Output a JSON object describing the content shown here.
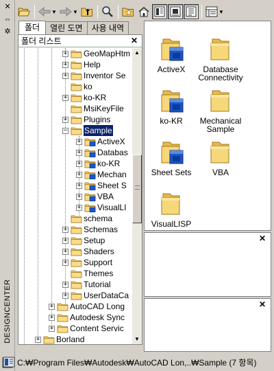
{
  "panel_title": "DESIGNCENTER",
  "tabs": [
    {
      "label": "폴더",
      "active": true
    },
    {
      "label": "열린 도면",
      "active": false
    },
    {
      "label": "사용 내역",
      "active": false
    }
  ],
  "tree_header": "폴더 리스트",
  "tree": [
    {
      "label": "GeoMapHtm"
    },
    {
      "label": "Help"
    },
    {
      "label": "Inventor Se"
    },
    {
      "label": "ko"
    },
    {
      "label": "ko-KR"
    },
    {
      "label": "MsiKeyFile"
    },
    {
      "label": "Plugins"
    },
    {
      "label": "Sample",
      "selected": true
    },
    {
      "label": "ActiveX"
    },
    {
      "label": "Databas"
    },
    {
      "label": "ko-KR"
    },
    {
      "label": "Mechan"
    },
    {
      "label": "Sheet S"
    },
    {
      "label": "VBA"
    },
    {
      "label": "VisualLI"
    },
    {
      "label": "schema"
    },
    {
      "label": "Schemas"
    },
    {
      "label": "Setup"
    },
    {
      "label": "Shaders"
    },
    {
      "label": "Support"
    },
    {
      "label": "Themes"
    },
    {
      "label": "Tutorial"
    },
    {
      "label": "UserDataCa"
    },
    {
      "label": "AutoCAD Long"
    },
    {
      "label": "Autodesk Sync"
    },
    {
      "label": "Content Servic"
    },
    {
      "label": "Borland"
    }
  ],
  "content_items": [
    {
      "label1": "ActiveX",
      "label2": ""
    },
    {
      "label1": "Database",
      "label2": "Connectivity"
    },
    {
      "label1": "ko-KR",
      "label2": ""
    },
    {
      "label1": "Mechanical",
      "label2": "Sample"
    },
    {
      "label1": "Sheet Sets",
      "label2": ""
    },
    {
      "label1": "VBA",
      "label2": ""
    },
    {
      "label1": "VisualLISP",
      "label2": ""
    }
  ],
  "status_path": "C:₩Program Files₩Autodesk₩AutoCAD Lon,..₩Sample (7 항목)",
  "colors": {
    "selection": "#0a246a",
    "folder": "#f0c860",
    "panel_bg": "#d4d0c8"
  }
}
